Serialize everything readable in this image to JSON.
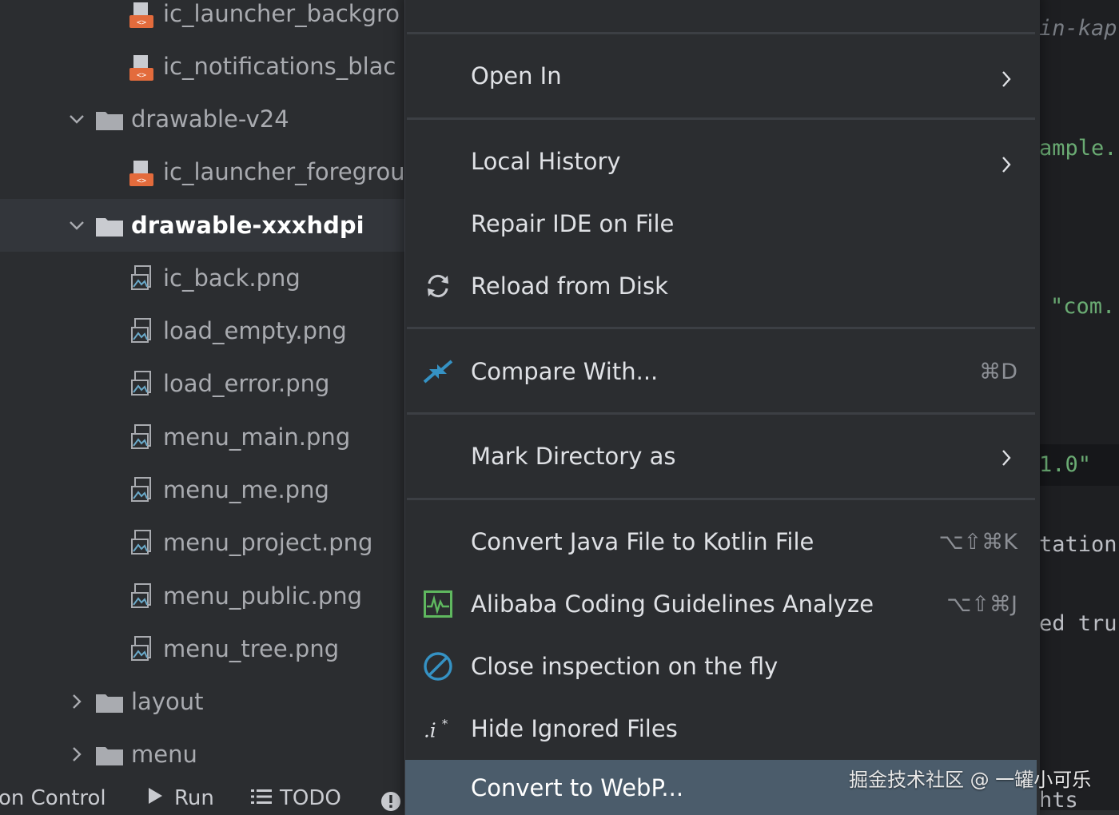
{
  "tree": {
    "items": [
      {
        "label": "ic_launcher_backgro"
      },
      {
        "label": "ic_notifications_blac"
      },
      {
        "label": "drawable-v24"
      },
      {
        "label": "ic_launcher_foregrou"
      },
      {
        "label": "drawable-xxxhdpi"
      },
      {
        "label": "ic_back.png"
      },
      {
        "label": "load_empty.png"
      },
      {
        "label": "load_error.png"
      },
      {
        "label": "menu_main.png"
      },
      {
        "label": "menu_me.png"
      },
      {
        "label": "menu_project.png"
      },
      {
        "label": "menu_public.png"
      },
      {
        "label": "menu_tree.png"
      },
      {
        "label": "layout"
      },
      {
        "label": "menu"
      }
    ]
  },
  "statusbar": {
    "version_control": "on Control",
    "run": "Run",
    "todo": "TODO"
  },
  "editor": {
    "lines": [
      "in-kap",
      "ample.",
      "\"com.",
      "1.0\"",
      "tation",
      "ed tru",
      "hts"
    ]
  },
  "menu": {
    "items": [
      {
        "label": "Open In",
        "submenu": true
      },
      {
        "label": "Local History",
        "submenu": true
      },
      {
        "label": "Repair IDE on File"
      },
      {
        "label": "Reload from Disk",
        "icon": "reload-icon"
      },
      {
        "label": "Compare With...",
        "shortcut": "⌘D",
        "icon": "compare-icon"
      },
      {
        "label": "Mark Directory as",
        "submenu": true
      },
      {
        "label": "Convert Java File to Kotlin File",
        "shortcut": "⌥⇧⌘K"
      },
      {
        "label": "Alibaba Coding Guidelines Analyze",
        "shortcut": "⌥⇧⌘J",
        "icon": "analyze-icon"
      },
      {
        "label": "Close inspection on the fly",
        "icon": "prohibit-icon"
      },
      {
        "label": "Hide Ignored Files",
        "icon": "ignored-files-icon"
      },
      {
        "label": "Convert to WebP...",
        "highlighted": true
      }
    ]
  },
  "watermark": "掘金技术社区 @ 一罐小可乐",
  "colors": {
    "background": "#2b2d30",
    "editor_bg": "#1e1f22",
    "highlight": "#4b5c6b",
    "accent_blue": "#3592c4"
  }
}
